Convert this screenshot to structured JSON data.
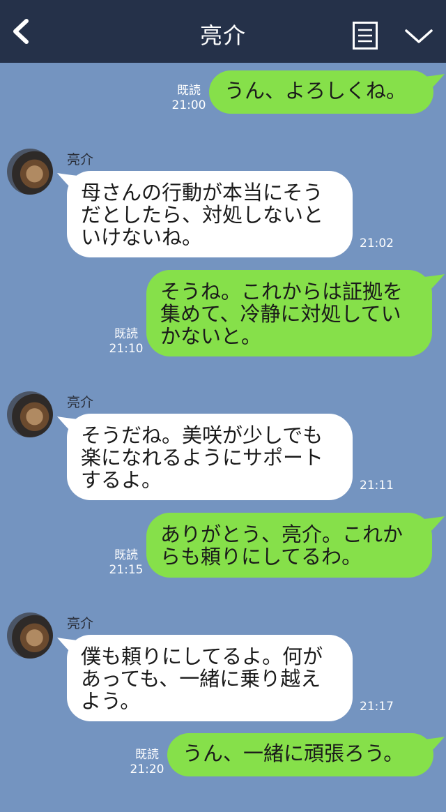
{
  "header": {
    "title": "亮介"
  },
  "colors": {
    "header_bg": "#253149",
    "chat_bg": "#7494c0",
    "sent_bubble": "#86e04a",
    "received_bubble": "#ffffff"
  },
  "messages": [
    {
      "side": "right",
      "text": "うん、よろしくね。",
      "read": "既読",
      "time": "21:00"
    },
    {
      "side": "left",
      "sender": "亮介",
      "text": "母さんの行動が本当にそう\nだとしたら、対処しないと\nいけないね。",
      "time": "21:02"
    },
    {
      "side": "right",
      "text": "そうね。これからは証拠を\n集めて、冷静に対処してい\nかないと。",
      "read": "既読",
      "time": "21:10"
    },
    {
      "side": "left",
      "sender": "亮介",
      "text": "そうだね。美咲が少しでも\n楽になれるようにサポート\nするよ。",
      "time": "21:11"
    },
    {
      "side": "right",
      "text": "ありがとう、亮介。これか\nらも頼りにしてるわ。",
      "read": "既読",
      "time": "21:15"
    },
    {
      "side": "left",
      "sender": "亮介",
      "text": "僕も頼りにしてるよ。何が\nあっても、一緒に乗り越え\nよう。",
      "time": "21:17"
    },
    {
      "side": "right",
      "text": "うん、一緒に頑張ろう。",
      "read": "既読",
      "time": "21:20"
    }
  ]
}
